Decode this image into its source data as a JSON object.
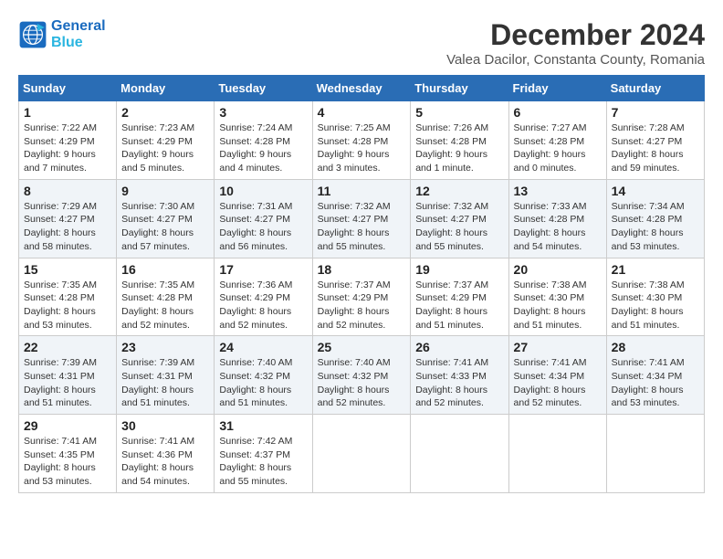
{
  "logo": {
    "line1": "General",
    "line2": "Blue"
  },
  "title": "December 2024",
  "subtitle": "Valea Dacilor, Constanta County, Romania",
  "days_header": [
    "Sunday",
    "Monday",
    "Tuesday",
    "Wednesday",
    "Thursday",
    "Friday",
    "Saturday"
  ],
  "weeks": [
    [
      {
        "day": "1",
        "info": "Sunrise: 7:22 AM\nSunset: 4:29 PM\nDaylight: 9 hours and 7 minutes."
      },
      {
        "day": "2",
        "info": "Sunrise: 7:23 AM\nSunset: 4:29 PM\nDaylight: 9 hours and 5 minutes."
      },
      {
        "day": "3",
        "info": "Sunrise: 7:24 AM\nSunset: 4:28 PM\nDaylight: 9 hours and 4 minutes."
      },
      {
        "day": "4",
        "info": "Sunrise: 7:25 AM\nSunset: 4:28 PM\nDaylight: 9 hours and 3 minutes."
      },
      {
        "day": "5",
        "info": "Sunrise: 7:26 AM\nSunset: 4:28 PM\nDaylight: 9 hours and 1 minute."
      },
      {
        "day": "6",
        "info": "Sunrise: 7:27 AM\nSunset: 4:28 PM\nDaylight: 9 hours and 0 minutes."
      },
      {
        "day": "7",
        "info": "Sunrise: 7:28 AM\nSunset: 4:27 PM\nDaylight: 8 hours and 59 minutes."
      }
    ],
    [
      {
        "day": "8",
        "info": "Sunrise: 7:29 AM\nSunset: 4:27 PM\nDaylight: 8 hours and 58 minutes."
      },
      {
        "day": "9",
        "info": "Sunrise: 7:30 AM\nSunset: 4:27 PM\nDaylight: 8 hours and 57 minutes."
      },
      {
        "day": "10",
        "info": "Sunrise: 7:31 AM\nSunset: 4:27 PM\nDaylight: 8 hours and 56 minutes."
      },
      {
        "day": "11",
        "info": "Sunrise: 7:32 AM\nSunset: 4:27 PM\nDaylight: 8 hours and 55 minutes."
      },
      {
        "day": "12",
        "info": "Sunrise: 7:32 AM\nSunset: 4:27 PM\nDaylight: 8 hours and 55 minutes."
      },
      {
        "day": "13",
        "info": "Sunrise: 7:33 AM\nSunset: 4:28 PM\nDaylight: 8 hours and 54 minutes."
      },
      {
        "day": "14",
        "info": "Sunrise: 7:34 AM\nSunset: 4:28 PM\nDaylight: 8 hours and 53 minutes."
      }
    ],
    [
      {
        "day": "15",
        "info": "Sunrise: 7:35 AM\nSunset: 4:28 PM\nDaylight: 8 hours and 53 minutes."
      },
      {
        "day": "16",
        "info": "Sunrise: 7:35 AM\nSunset: 4:28 PM\nDaylight: 8 hours and 52 minutes."
      },
      {
        "day": "17",
        "info": "Sunrise: 7:36 AM\nSunset: 4:29 PM\nDaylight: 8 hours and 52 minutes."
      },
      {
        "day": "18",
        "info": "Sunrise: 7:37 AM\nSunset: 4:29 PM\nDaylight: 8 hours and 52 minutes."
      },
      {
        "day": "19",
        "info": "Sunrise: 7:37 AM\nSunset: 4:29 PM\nDaylight: 8 hours and 51 minutes."
      },
      {
        "day": "20",
        "info": "Sunrise: 7:38 AM\nSunset: 4:30 PM\nDaylight: 8 hours and 51 minutes."
      },
      {
        "day": "21",
        "info": "Sunrise: 7:38 AM\nSunset: 4:30 PM\nDaylight: 8 hours and 51 minutes."
      }
    ],
    [
      {
        "day": "22",
        "info": "Sunrise: 7:39 AM\nSunset: 4:31 PM\nDaylight: 8 hours and 51 minutes."
      },
      {
        "day": "23",
        "info": "Sunrise: 7:39 AM\nSunset: 4:31 PM\nDaylight: 8 hours and 51 minutes."
      },
      {
        "day": "24",
        "info": "Sunrise: 7:40 AM\nSunset: 4:32 PM\nDaylight: 8 hours and 51 minutes."
      },
      {
        "day": "25",
        "info": "Sunrise: 7:40 AM\nSunset: 4:32 PM\nDaylight: 8 hours and 52 minutes."
      },
      {
        "day": "26",
        "info": "Sunrise: 7:41 AM\nSunset: 4:33 PM\nDaylight: 8 hours and 52 minutes."
      },
      {
        "day": "27",
        "info": "Sunrise: 7:41 AM\nSunset: 4:34 PM\nDaylight: 8 hours and 52 minutes."
      },
      {
        "day": "28",
        "info": "Sunrise: 7:41 AM\nSunset: 4:34 PM\nDaylight: 8 hours and 53 minutes."
      }
    ],
    [
      {
        "day": "29",
        "info": "Sunrise: 7:41 AM\nSunset: 4:35 PM\nDaylight: 8 hours and 53 minutes."
      },
      {
        "day": "30",
        "info": "Sunrise: 7:41 AM\nSunset: 4:36 PM\nDaylight: 8 hours and 54 minutes."
      },
      {
        "day": "31",
        "info": "Sunrise: 7:42 AM\nSunset: 4:37 PM\nDaylight: 8 hours and 55 minutes."
      },
      null,
      null,
      null,
      null
    ]
  ]
}
